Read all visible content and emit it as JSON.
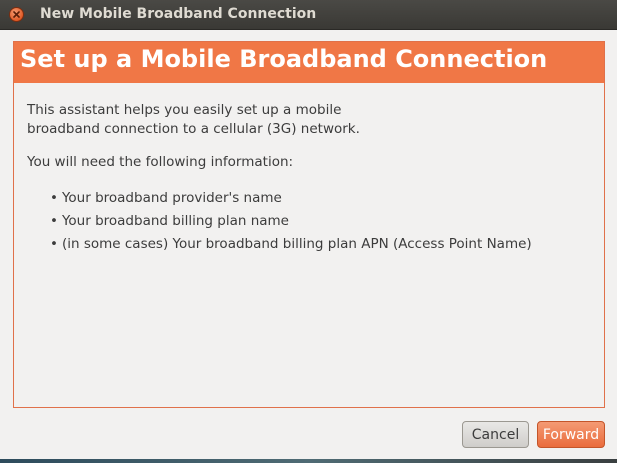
{
  "window": {
    "title": "New Mobile Broadband Connection"
  },
  "banner": {
    "title": "Set up a Mobile Broadband Connection"
  },
  "intro": {
    "line1": "This assistant helps you easily set up a mobile",
    "line2": "broadband connection to a cellular (3G) network."
  },
  "info_heading": "You will need the following information:",
  "bullets": [
    "Your broadband provider's name",
    "Your broadband billing plan name",
    "(in some cases) Your broadband billing plan APN (Access Point Name)"
  ],
  "bullet_char": "•",
  "buttons": {
    "cancel": "Cancel",
    "forward": "Forward"
  },
  "colors": {
    "accent": "#f07746",
    "border": "#e0714a"
  },
  "icons": {
    "close": "close-icon"
  }
}
